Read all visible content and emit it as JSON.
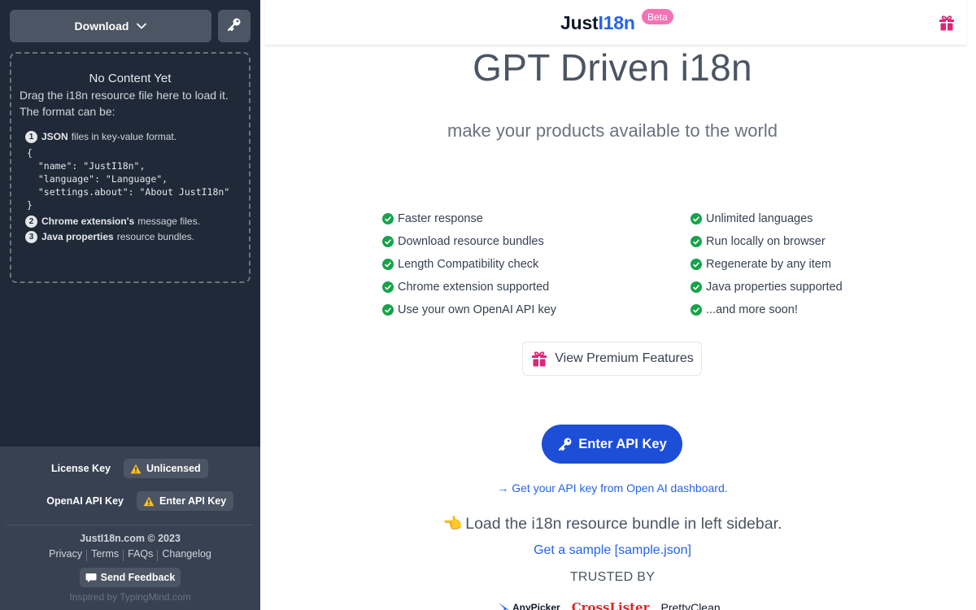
{
  "sidebar": {
    "download_label": "Download",
    "dropzone": {
      "title": "No Content Yet",
      "desc": "Drag the i18n resource file here to load it. The format can be:",
      "items": [
        {
          "num": "1",
          "bold": "JSON",
          "rest": "files in key-value format."
        },
        {
          "num": "2",
          "bold": "Chrome extension's",
          "rest": "message files."
        },
        {
          "num": "3",
          "bold": "Java properties",
          "rest": "resource bundles."
        }
      ],
      "code": "{\n  \"name\": \"JustI18n\",\n  \"language\": \"Language\",\n  \"settings.about\": \"About JustI18n\"\n}"
    },
    "license": {
      "label": "License Key",
      "value": "Unlicensed"
    },
    "openai": {
      "label": "OpenAI API Key",
      "value": "Enter API Key"
    },
    "copyright": "JustI18n.com © 2023",
    "links": [
      "Privacy",
      "Terms",
      "FAQs",
      "Changelog"
    ],
    "feedback": "Send Feedback",
    "inspired": "Inspired by TypingMind.com"
  },
  "header": {
    "logo_a": "Just",
    "logo_b": "I18n",
    "badge": "Beta"
  },
  "main": {
    "headline": "GPT Driven i18n",
    "subline": "make your products available to the world",
    "features_left": [
      "Faster response",
      "Download resource bundles",
      "Length Compatibility check",
      "Chrome extension supported",
      "Use your own OpenAI API key"
    ],
    "features_right": [
      "Unlimited languages",
      "Run locally on browser",
      "Regenerate by any item",
      "Java properties supported",
      "...and more soon!"
    ],
    "premium_label": "View Premium Features",
    "enter_key_label": "Enter API Key",
    "api_link": "→ Get your API key from Open AI dashboard.",
    "load_hand": "👈",
    "load_text": "Load the i18n resource bundle in left sidebar.",
    "sample_link": "Get a sample [sample.json]",
    "trusted": "TRUSTED BY",
    "brands": [
      "AnyPicker",
      "CrossLister",
      "PrettyClean"
    ]
  },
  "colors": {
    "sidebar_bg": "#1f2937",
    "accent": "#2563eb",
    "check": "#16a34a",
    "badge": "#f472b6",
    "gift": "#db2777"
  },
  "icons": [
    "chevron-down-icon",
    "key-icon",
    "warning-icon",
    "gift-icon",
    "check-icon",
    "chat-icon",
    "pointing-hand-icon"
  ]
}
